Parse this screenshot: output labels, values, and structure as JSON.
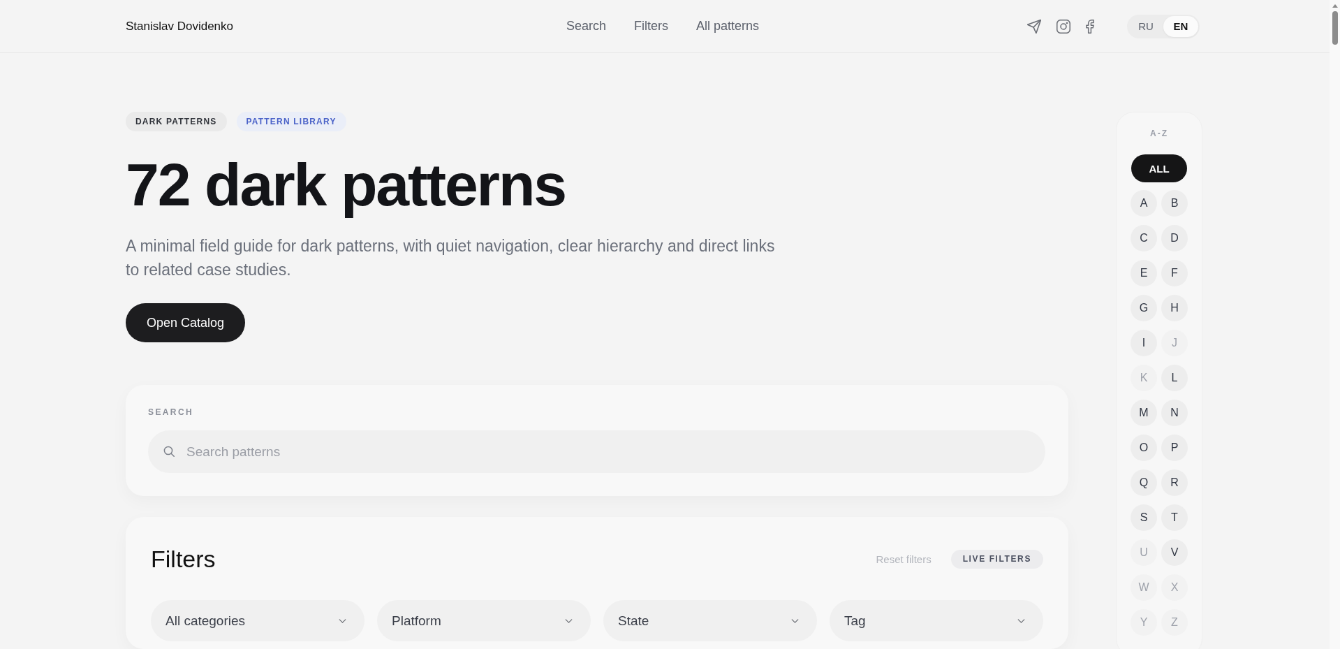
{
  "header": {
    "brand": "Stanislav Dovidenko",
    "nav": [
      {
        "label": "Search"
      },
      {
        "label": "Filters"
      },
      {
        "label": "All patterns"
      }
    ],
    "languages": [
      {
        "label": "RU",
        "selected": false
      },
      {
        "label": "EN",
        "selected": true
      }
    ]
  },
  "hero": {
    "tags": [
      {
        "label": "DARK PATTERNS",
        "kind": "neutral"
      },
      {
        "label": "PATTERN LIBRARY",
        "kind": "accent"
      }
    ],
    "title": "72 dark patterns",
    "subtitle": "A minimal field guide for dark patterns, with quiet navigation, clear hierarchy and direct links to related case studies.",
    "button": "Open Catalog"
  },
  "search": {
    "label": "SEARCH",
    "placeholder": "Search patterns"
  },
  "filters": {
    "title": "Filters",
    "reset": "Reset filters",
    "badge": "LIVE FILTERS",
    "selects": [
      {
        "label": "All categories"
      },
      {
        "label": "Platform"
      },
      {
        "label": "State"
      },
      {
        "label": "Tag"
      }
    ]
  },
  "alphabet": {
    "label": "A-Z",
    "all": {
      "label": "ALL",
      "selected": true
    },
    "letters": [
      {
        "label": "A",
        "selected": false,
        "disabled": false
      },
      {
        "label": "B",
        "selected": false,
        "disabled": false
      },
      {
        "label": "C",
        "selected": false,
        "disabled": false
      },
      {
        "label": "D",
        "selected": false,
        "disabled": false
      },
      {
        "label": "E",
        "selected": false,
        "disabled": false
      },
      {
        "label": "F",
        "selected": false,
        "disabled": false
      },
      {
        "label": "G",
        "selected": false,
        "disabled": false
      },
      {
        "label": "H",
        "selected": false,
        "disabled": false
      },
      {
        "label": "I",
        "selected": false,
        "disabled": false
      },
      {
        "label": "J",
        "selected": false,
        "disabled": true
      },
      {
        "label": "K",
        "selected": false,
        "disabled": true
      },
      {
        "label": "L",
        "selected": false,
        "disabled": false
      },
      {
        "label": "M",
        "selected": false,
        "disabled": false
      },
      {
        "label": "N",
        "selected": false,
        "disabled": false
      },
      {
        "label": "O",
        "selected": false,
        "disabled": false
      },
      {
        "label": "P",
        "selected": false,
        "disabled": false
      },
      {
        "label": "Q",
        "selected": false,
        "disabled": false
      },
      {
        "label": "R",
        "selected": false,
        "disabled": false
      },
      {
        "label": "S",
        "selected": false,
        "disabled": false
      },
      {
        "label": "T",
        "selected": false,
        "disabled": false
      },
      {
        "label": "U",
        "selected": false,
        "disabled": true
      },
      {
        "label": "V",
        "selected": false,
        "disabled": false
      },
      {
        "label": "W",
        "selected": false,
        "disabled": true
      },
      {
        "label": "X",
        "selected": false,
        "disabled": true
      },
      {
        "label": "Y",
        "selected": false,
        "disabled": true
      },
      {
        "label": "Z",
        "selected": false,
        "disabled": true
      }
    ]
  }
}
